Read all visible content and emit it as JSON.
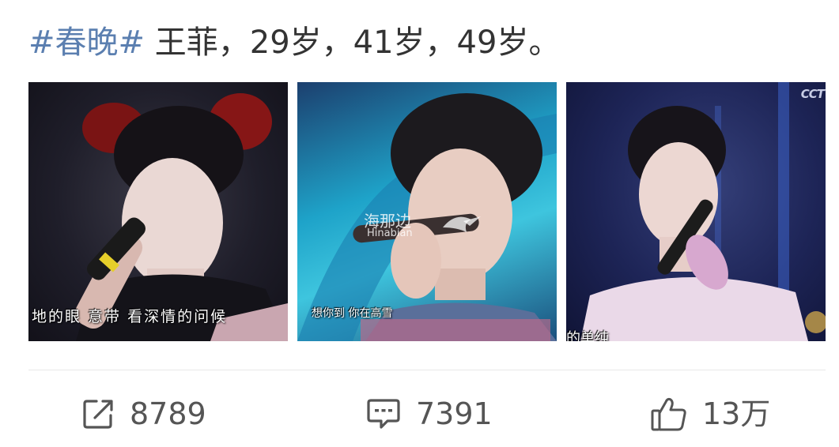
{
  "post": {
    "hashtag": "#春晚#",
    "text": " 王菲，29岁，41岁，49岁。"
  },
  "photos": [
    {
      "subtitle": "地的眼 意带 看深情的问候"
    },
    {
      "subtitle": "想你到 你在高雪",
      "watermark_zh": "海那边",
      "watermark_en": "Hinabian"
    },
    {
      "subtitle": "的单纯",
      "logo": "CCT"
    }
  ],
  "actions": {
    "repost_count": "8789",
    "comment_count": "7391",
    "like_count": "13万"
  },
  "colors": {
    "hashtag": "#5b7fb0",
    "text": "#333333",
    "icon": "#555555",
    "divider": "#e8e8e8"
  },
  "icons": [
    "repost-icon",
    "comment-icon",
    "thumbs-up-icon"
  ]
}
